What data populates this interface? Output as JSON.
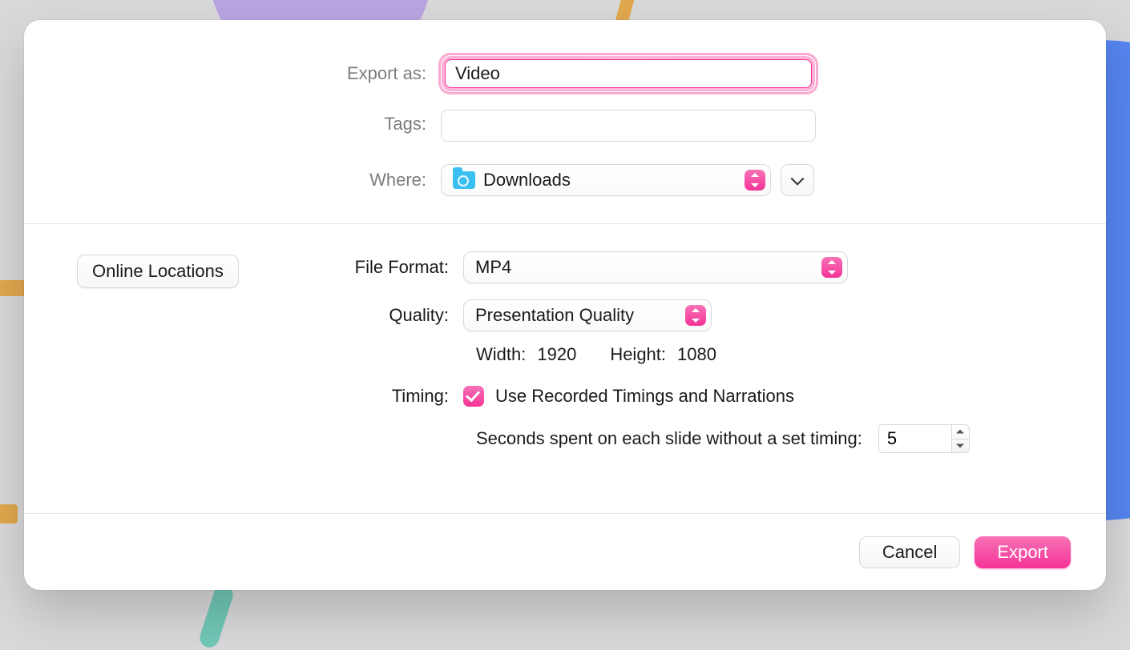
{
  "labels": {
    "export_as": "Export as:",
    "tags": "Tags:",
    "where": "Where:",
    "file_format": "File Format:",
    "quality": "Quality:",
    "timing": "Timing:",
    "width": "Width:",
    "height": "Height:"
  },
  "filename": "Video",
  "tags_value": "",
  "location": {
    "name": "Downloads"
  },
  "online_locations_label": "Online Locations",
  "file_format": "MP4",
  "quality": "Presentation Quality",
  "dimensions": {
    "width": "1920",
    "height": "1080"
  },
  "timing": {
    "use_recorded_label": "Use Recorded Timings and Narrations",
    "use_recorded_checked": true,
    "seconds_label": "Seconds spent on each slide without a set timing:",
    "seconds_value": "5"
  },
  "buttons": {
    "cancel": "Cancel",
    "export": "Export"
  }
}
